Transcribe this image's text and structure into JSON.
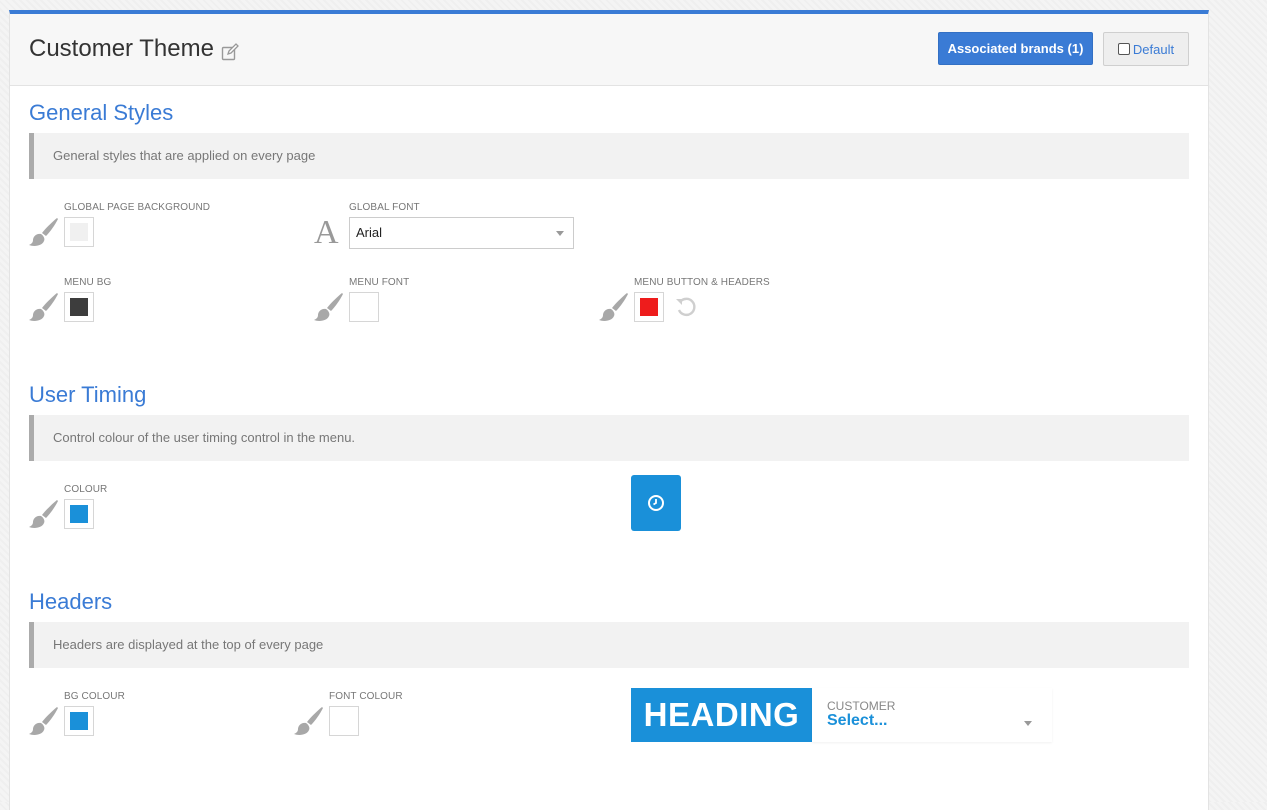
{
  "header": {
    "title": "Customer Theme",
    "associated_brands_label": "Associated brands",
    "associated_brands_count": "(1)",
    "default_label": "Default"
  },
  "sections": {
    "general": {
      "title": "General Styles",
      "description": "General styles that are applied on every page",
      "global_bg_label": "GLOBAL PAGE BACKGROUND",
      "global_bg_color": "#f0f0f0",
      "global_font_label": "GLOBAL FONT",
      "global_font_value": "Arial",
      "menu_bg_label": "MENU BG",
      "menu_bg_color": "#3d3d3d",
      "menu_font_label": "MENU FONT",
      "menu_font_color": "#ffffff",
      "menu_button_label": "MENU BUTTON & HEADERS",
      "menu_button_color": "#ee1c1c"
    },
    "user_timing": {
      "title": "User Timing",
      "description": "Control colour of the user timing control in the menu.",
      "colour_label": "COLOUR",
      "colour": "#1a90d9"
    },
    "headers": {
      "title": "Headers",
      "description": "Headers are displayed at the top of every page",
      "bg_colour_label": "BG COLOUR",
      "bg_colour": "#1a90d9",
      "font_colour_label": "FONT COLOUR",
      "font_colour": "#ffffff",
      "preview_heading": "HEADING",
      "preview_customer_label": "CUSTOMER",
      "preview_customer_value": "Select..."
    }
  },
  "colors": {
    "accent": "#3a7bd5",
    "timer": "#1a90d9"
  }
}
